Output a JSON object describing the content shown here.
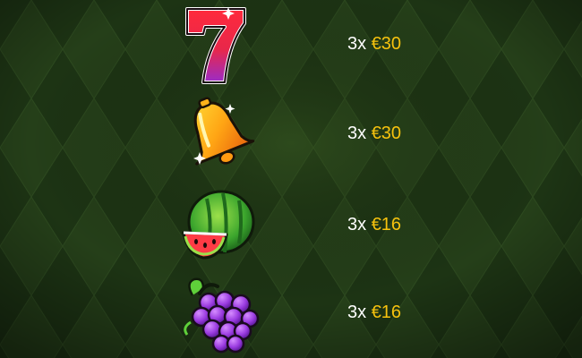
{
  "colors": {
    "background": "#1c3312",
    "multiplier_text": "#ffffff",
    "amount_text": "#f6c20e"
  },
  "paytable": {
    "rows": [
      {
        "symbol_icon": "seven-icon",
        "multiplier": "3x",
        "amount": "€30"
      },
      {
        "symbol_icon": "bell-icon",
        "multiplier": "3x",
        "amount": "€30"
      },
      {
        "symbol_icon": "watermelon-icon",
        "multiplier": "3x",
        "amount": "€16"
      },
      {
        "symbol_icon": "grapes-icon",
        "multiplier": "3x",
        "amount": "€16"
      }
    ]
  }
}
